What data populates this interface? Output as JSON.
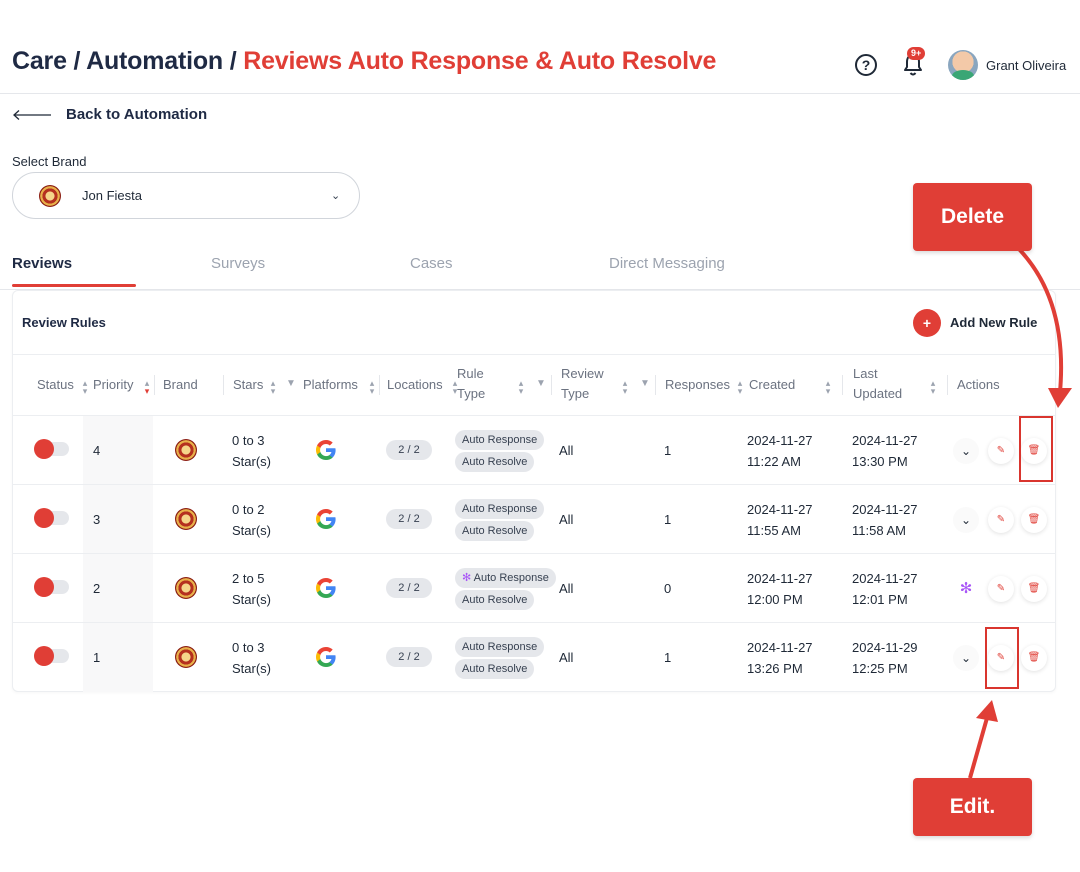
{
  "header": {
    "crumb_care": "Care",
    "crumb_sep1": " / ",
    "crumb_automation": "Automation",
    "crumb_sep2": " / ",
    "crumb_current": "Reviews Auto Response & Auto Resolve",
    "help_glyph": "?",
    "notification_badge": "9+",
    "user_name": "Grant Oliveira"
  },
  "back_link": {
    "label": "Back to Automation"
  },
  "brand_select": {
    "label": "Select Brand",
    "value": "Jon Fiesta",
    "chevron": "⌄"
  },
  "tabs": [
    {
      "label": "Reviews",
      "active": true
    },
    {
      "label": "Surveys",
      "active": false
    },
    {
      "label": "Cases",
      "active": false
    },
    {
      "label": "Direct Messaging",
      "active": false
    }
  ],
  "card": {
    "title": "Review Rules",
    "add_glyph": "+",
    "add_label": "Add New Rule"
  },
  "table": {
    "headers": {
      "status": "Status",
      "priority": "Priority",
      "brand": "Brand",
      "stars": "Stars",
      "platforms": "Platforms",
      "locations": "Locations",
      "rule_type_1": "Rule",
      "rule_type_2": "Type",
      "review_type_1": "Review",
      "review_type_2": "Type",
      "responses": "Responses",
      "created": "Created",
      "last_updated_1": "Last",
      "last_updated_2": "Updated",
      "actions": "Actions"
    },
    "rows": [
      {
        "priority": "4",
        "stars_1": "0 to 3",
        "stars_2": "Star(s)",
        "locations": "2 / 2",
        "rule_type_1": "Auto Response",
        "rule_type_2": "Auto Resolve",
        "review_type": "All",
        "responses": "1",
        "created_1": "2024-11-27",
        "created_2": "11:22 AM",
        "updated_1": "2024-11-27",
        "updated_2": "13:30 PM",
        "first_action": "expand"
      },
      {
        "priority": "3",
        "stars_1": "0 to 2",
        "stars_2": "Star(s)",
        "locations": "2 / 2",
        "rule_type_1": "Auto Response",
        "rule_type_2": "Auto Resolve",
        "review_type": "All",
        "responses": "1",
        "created_1": "2024-11-27",
        "created_2": "11:55 AM",
        "updated_1": "2024-11-27",
        "updated_2": "11:58 AM",
        "first_action": "expand"
      },
      {
        "priority": "2",
        "stars_1": "2 to 5",
        "stars_2": "Star(s)",
        "locations": "2 / 2",
        "rule_type_1": "Auto Response",
        "rule_type_2": "Auto Resolve",
        "review_type": "All",
        "responses": "0",
        "created_1": "2024-11-27",
        "created_2": "12:00 PM",
        "updated_1": "2024-11-27",
        "updated_2": "12:01 PM",
        "first_action": "ai"
      },
      {
        "priority": "1",
        "stars_1": "0 to 3",
        "stars_2": "Star(s)",
        "locations": "2 / 2",
        "rule_type_1": "Auto Response",
        "rule_type_2": "Auto Resolve",
        "review_type": "All",
        "responses": "1",
        "created_1": "2024-11-27",
        "created_2": "13:26 PM",
        "updated_1": "2024-11-29",
        "updated_2": "12:25 PM",
        "first_action": "expand"
      }
    ]
  },
  "annotations": {
    "delete_label": "Delete",
    "edit_label": "Edit."
  },
  "icons": {
    "help": "help-circle-icon",
    "bell": "bell-icon",
    "back": "arrow-left-icon",
    "expand": "chevron-down-icon",
    "edit": "pencil-icon",
    "delete": "trash-icon",
    "ai": "sparkle-icon",
    "platform": "google-icon",
    "brand": "jon-fiesta-logo"
  },
  "colors": {
    "accent": "#e03e36",
    "heading": "#1f2a44",
    "muted": "#9ca3af",
    "pill": "#e5e7eb",
    "ai": "#a855f7"
  }
}
